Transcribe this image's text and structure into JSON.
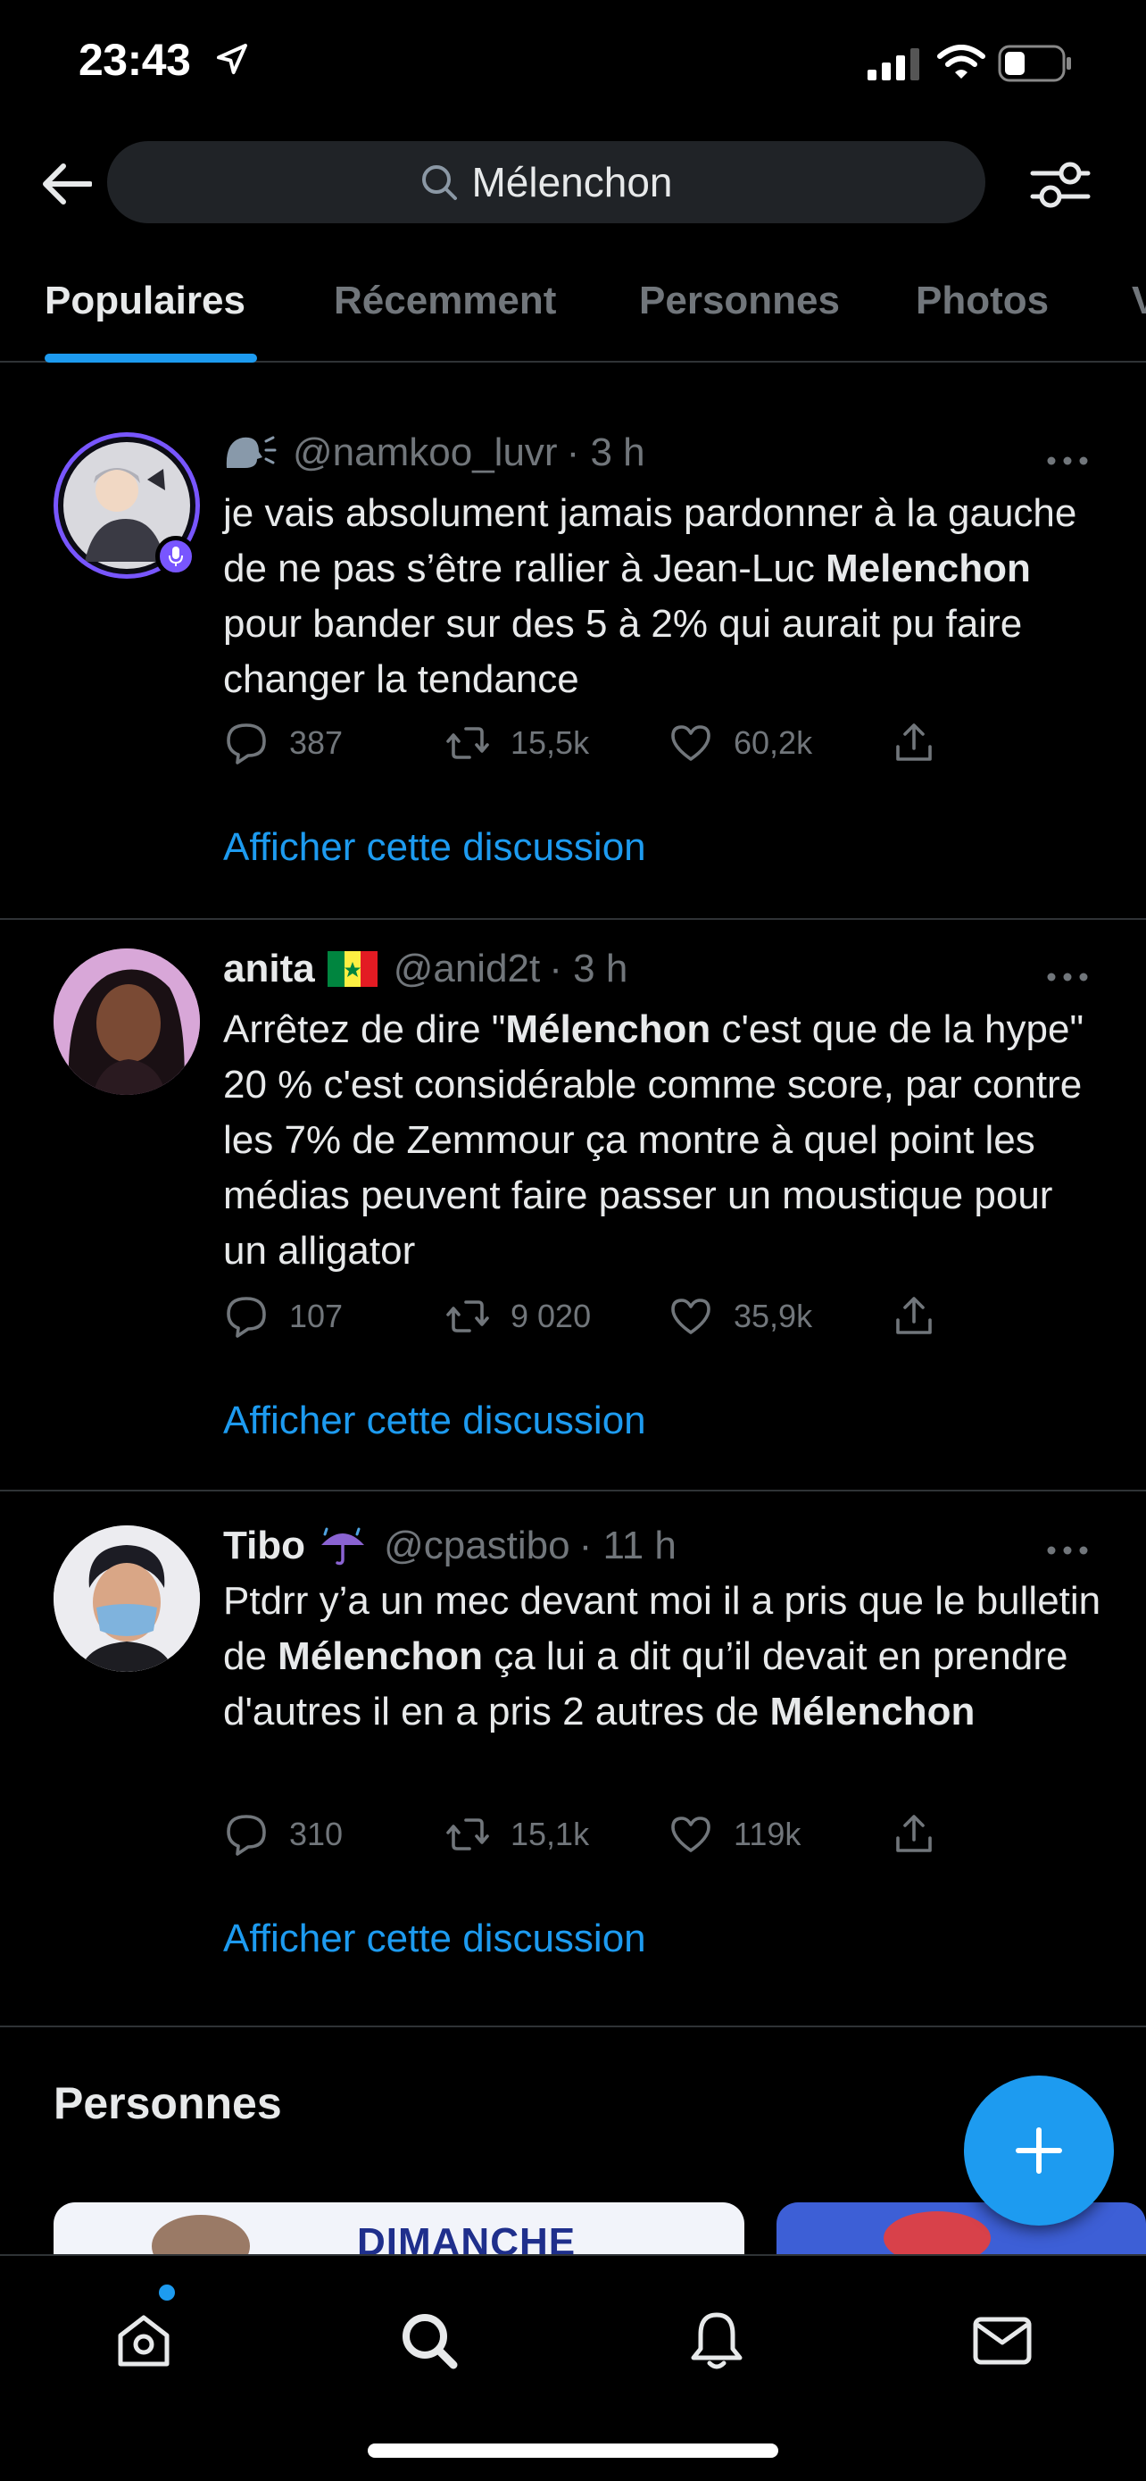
{
  "status_bar": {
    "time": "23:43",
    "icons": [
      "location-arrow-icon",
      "signal-icon",
      "wifi-icon",
      "battery-icon"
    ]
  },
  "header": {
    "search_query": "Mélenchon",
    "icons": [
      "back-arrow-icon",
      "search-icon",
      "filter-settings-icon"
    ]
  },
  "tabs": [
    {
      "label": "Populaires",
      "active": true
    },
    {
      "label": "Récemment",
      "active": false
    },
    {
      "label": "Personnes",
      "active": false
    },
    {
      "label": "Photos",
      "active": false
    },
    {
      "label": "V",
      "active": false
    }
  ],
  "tweets": [
    {
      "display_name": "",
      "name_emoji": "speaking-head-icon",
      "handle": "@namkoo_luvr",
      "time": "· 3 h",
      "text_parts": [
        {
          "text": "je vais absolument jamais pardonner à la gauche de ne pas s’être rallier à Jean-Luc ",
          "bold": false
        },
        {
          "text": "Melenchon",
          "bold": true
        },
        {
          "text": " pour bander sur des 5 à 2% qui aurait pu faire changer la tendance",
          "bold": false
        }
      ],
      "replies": "387",
      "retweets": "15,5k",
      "likes": "60,2k",
      "show_thread": "Afficher cette discussion"
    },
    {
      "display_name": "anita",
      "name_emoji": "senegal-flag-icon",
      "handle": "@anid2t",
      "time": "· 3 h",
      "text_parts": [
        {
          "text": "Arrêtez de dire \"",
          "bold": false
        },
        {
          "text": "Mélenchon",
          "bold": true
        },
        {
          "text": " c'est que de la hype\" 20 % c'est considérable comme score, par contre les 7% de Zemmour ça montre à quel point les médias peuvent faire passer un moustique pour un alligator",
          "bold": false
        }
      ],
      "replies": "107",
      "retweets": "9 020",
      "likes": "35,9k",
      "show_thread": "Afficher cette discussion"
    },
    {
      "display_name": "Tibo",
      "name_emoji": "umbrella-rain-icon",
      "handle": "@cpastibo",
      "time": "· 11 h",
      "text_parts": [
        {
          "text": "Ptdrr y’a un mec devant moi il a pris que le bulletin de ",
          "bold": false
        },
        {
          "text": "Mélenchon",
          "bold": true
        },
        {
          "text": " ça lui a dit qu’il devait en prendre d'autres il en a pris 2 autres de ",
          "bold": false
        },
        {
          "text": "Mélenchon",
          "bold": true
        }
      ],
      "replies": "310",
      "retweets": "15,1k",
      "likes": "119k",
      "show_thread": "Afficher cette discussion"
    }
  ],
  "people_section": {
    "title": "Personnes",
    "card_caption": "DIMANCHE"
  },
  "fab": {
    "icon": "plus-icon"
  },
  "colors": {
    "accent": "#1d9bf0",
    "background": "#000000",
    "muted": "#71767b",
    "text": "#e7e9ea"
  }
}
